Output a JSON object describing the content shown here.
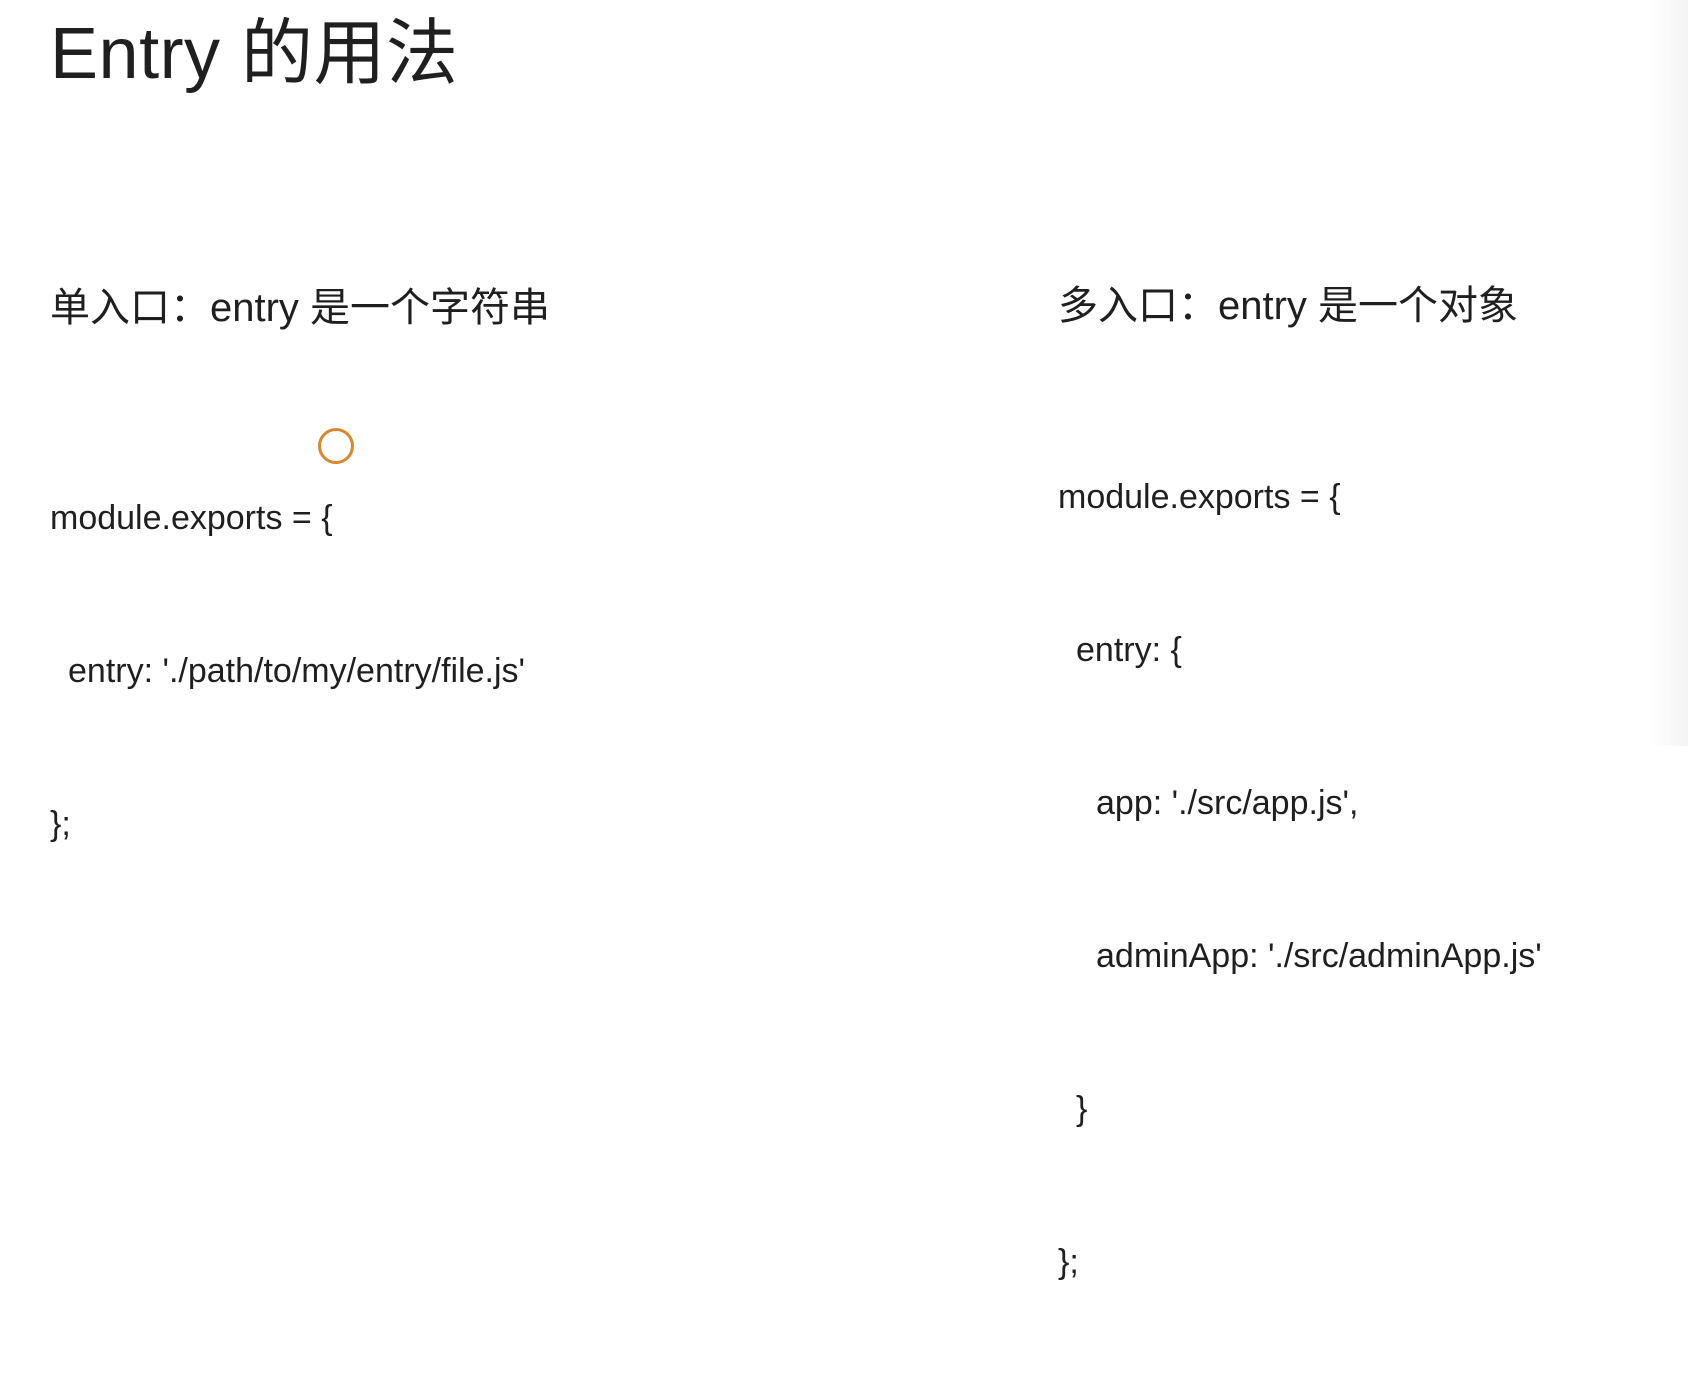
{
  "slide": {
    "title": "Entry 的用法",
    "single": {
      "heading": "单入口：entry 是一个字符串",
      "code_lines": [
        "module.exports = {",
        "entry: './path/to/my/entry/file.js'",
        "};"
      ]
    },
    "multiple": {
      "heading": "多入口：entry 是一个对象",
      "code_lines": [
        "module.exports = {",
        "entry: {",
        "app: './src/app.js',",
        "adminApp: './src/adminApp.js'",
        "}",
        "};"
      ]
    }
  },
  "colors": {
    "text": "#1f1f1f",
    "background": "#ffffff",
    "cursor_highlight": "#d9882d"
  },
  "icons": {
    "cursor": "circle-cursor-highlight-icon"
  }
}
